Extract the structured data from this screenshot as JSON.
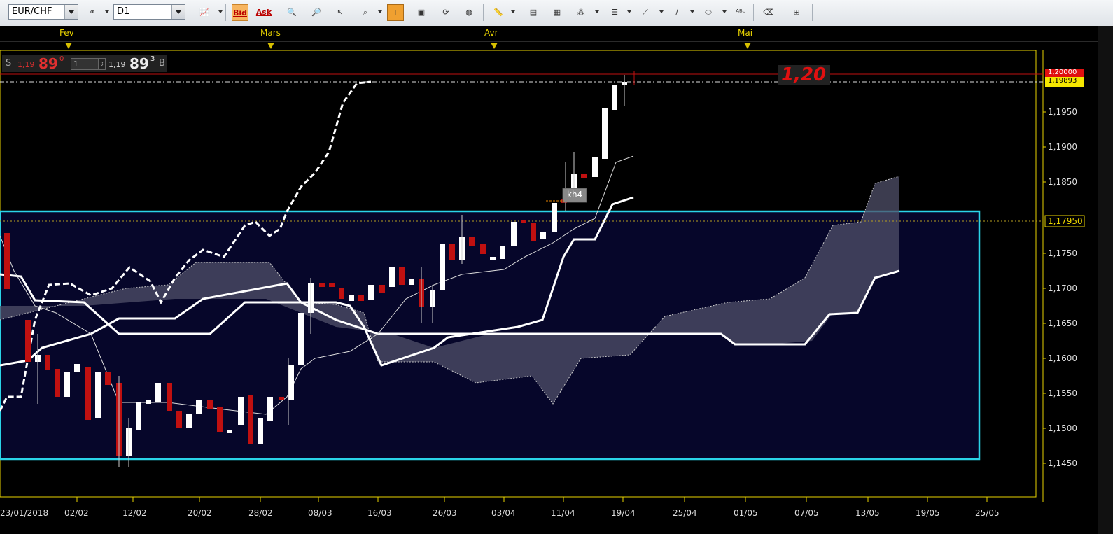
{
  "toolbar": {
    "symbol": "EUR/CHF",
    "timeframe": "D1",
    "bid_label": "Bid",
    "ask_label": "Ask"
  },
  "months": [
    "Fev",
    "Mars",
    "Avr",
    "Mai"
  ],
  "price_panel": {
    "sell_letter": "S",
    "sell_prefix": "1,19",
    "sell_big": "89",
    "sell_sup": "0",
    "lot": "1",
    "buy_prefix": "1,19",
    "buy_big": "89",
    "buy_sup": "3",
    "buy_letter": "B"
  },
  "annotation": "1,20",
  "tooltip_label": "kh4",
  "price_axis": {
    "ticks": [
      "1,1950",
      "1,1900",
      "1,1850",
      "1,1750",
      "1,1700",
      "1,1650",
      "1,1600",
      "1,1550",
      "1,1500",
      "1,1450"
    ],
    "red_tag": "1,20000",
    "yellow_tag": "1,19893",
    "dotted_tag": "1,17950"
  },
  "date_axis": {
    "ticks": [
      "23/01/2018",
      "02/02",
      "12/02",
      "20/02",
      "28/02",
      "08/03",
      "16/03",
      "26/03",
      "03/04",
      "11/04",
      "19/04",
      "25/04",
      "01/05",
      "07/05",
      "13/05",
      "19/05",
      "25/05"
    ]
  },
  "colors": {
    "bull": "#ffffff",
    "bear": "#c01010",
    "box": "#2ad4e8",
    "grid": "#e8d200"
  }
}
